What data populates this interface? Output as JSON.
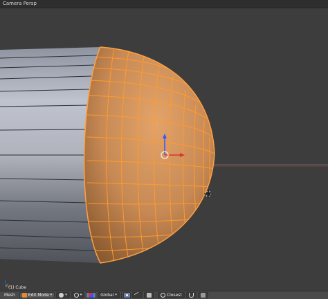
{
  "viewport": {
    "title": "Camera Persp",
    "object_info": "(1) Cube"
  },
  "header": {
    "view_label": "Mesh",
    "mode_label": "Edit Mode",
    "orientation_label": "Global",
    "proportional_label": "Closest"
  },
  "colors": {
    "background": "#3d3d3d",
    "selected_edge": "#ff9a2e",
    "selected_face": "#d98c4f",
    "unselected_face": "#a9adb8",
    "axis_x": "#d93333",
    "axis_z": "#3355ff"
  },
  "icons": {
    "mode_icon": "edit-mode-icon",
    "shading_icon": "solid-shading-icon",
    "pivot_icon": "pivot-icon",
    "manipulator_icon": "manipulator-icon",
    "vertex_select_icon": "vertex-select-icon",
    "edge_select_icon": "edge-select-icon",
    "face_select_icon": "face-select-icon",
    "snap_icon": "magnet-icon",
    "proportional_icon": "proportional-icon",
    "render_icon": "render-icon"
  }
}
